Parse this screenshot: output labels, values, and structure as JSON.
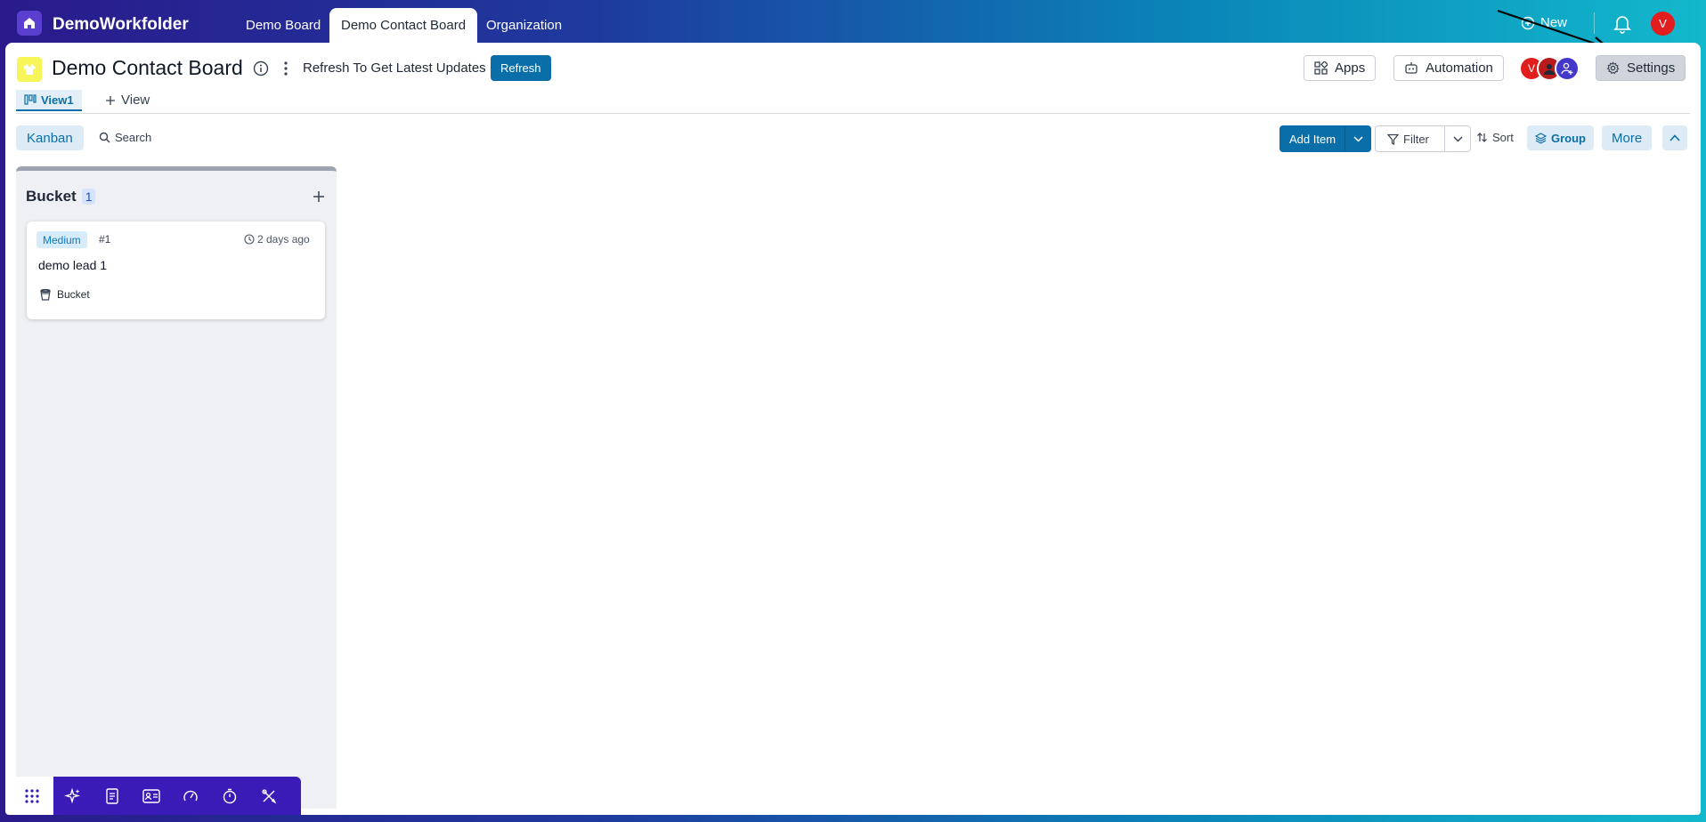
{
  "app": {
    "title": "DemoWorkfolder",
    "nav_tabs": [
      {
        "label": "Demo Board",
        "active": false
      },
      {
        "label": "Demo Contact Board",
        "active": true
      },
      {
        "label": "Organization",
        "active": false
      }
    ],
    "new_label": "New",
    "user_initial": "V"
  },
  "board": {
    "title": "Demo Contact Board",
    "refresh_text": "Refresh To Get Latest Updates",
    "refresh_button": "Refresh",
    "apps_button": "Apps",
    "automation_button": "Automation",
    "settings_button": "Settings",
    "members": [
      {
        "initial": "V",
        "color": "#e11d1d"
      },
      {
        "initial": "",
        "color": "#b91c1c"
      },
      {
        "initial": "",
        "color": "#4338ca"
      }
    ]
  },
  "views": {
    "active_view": "View1",
    "add_view": "View"
  },
  "toolbar": {
    "kanban": "Kanban",
    "search": "Search",
    "add_item": "Add Item",
    "filter": "Filter",
    "sort": "Sort",
    "group": "Group",
    "more": "More"
  },
  "columns": [
    {
      "title": "Bucket",
      "count": "1",
      "cards": [
        {
          "priority": "Medium",
          "id": "#1",
          "time": "2 days ago",
          "title": "demo lead 1",
          "bucket": "Bucket"
        }
      ]
    }
  ],
  "colors": {
    "accent": "#0a6fa8",
    "dock": "#3b1bb8",
    "badge_bg": "#d6ecfb"
  },
  "dock_icons": [
    "apps-grid-icon",
    "sparkle-icon",
    "document-icon",
    "contact-card-icon",
    "gauge-icon",
    "timer-icon",
    "tools-icon"
  ]
}
